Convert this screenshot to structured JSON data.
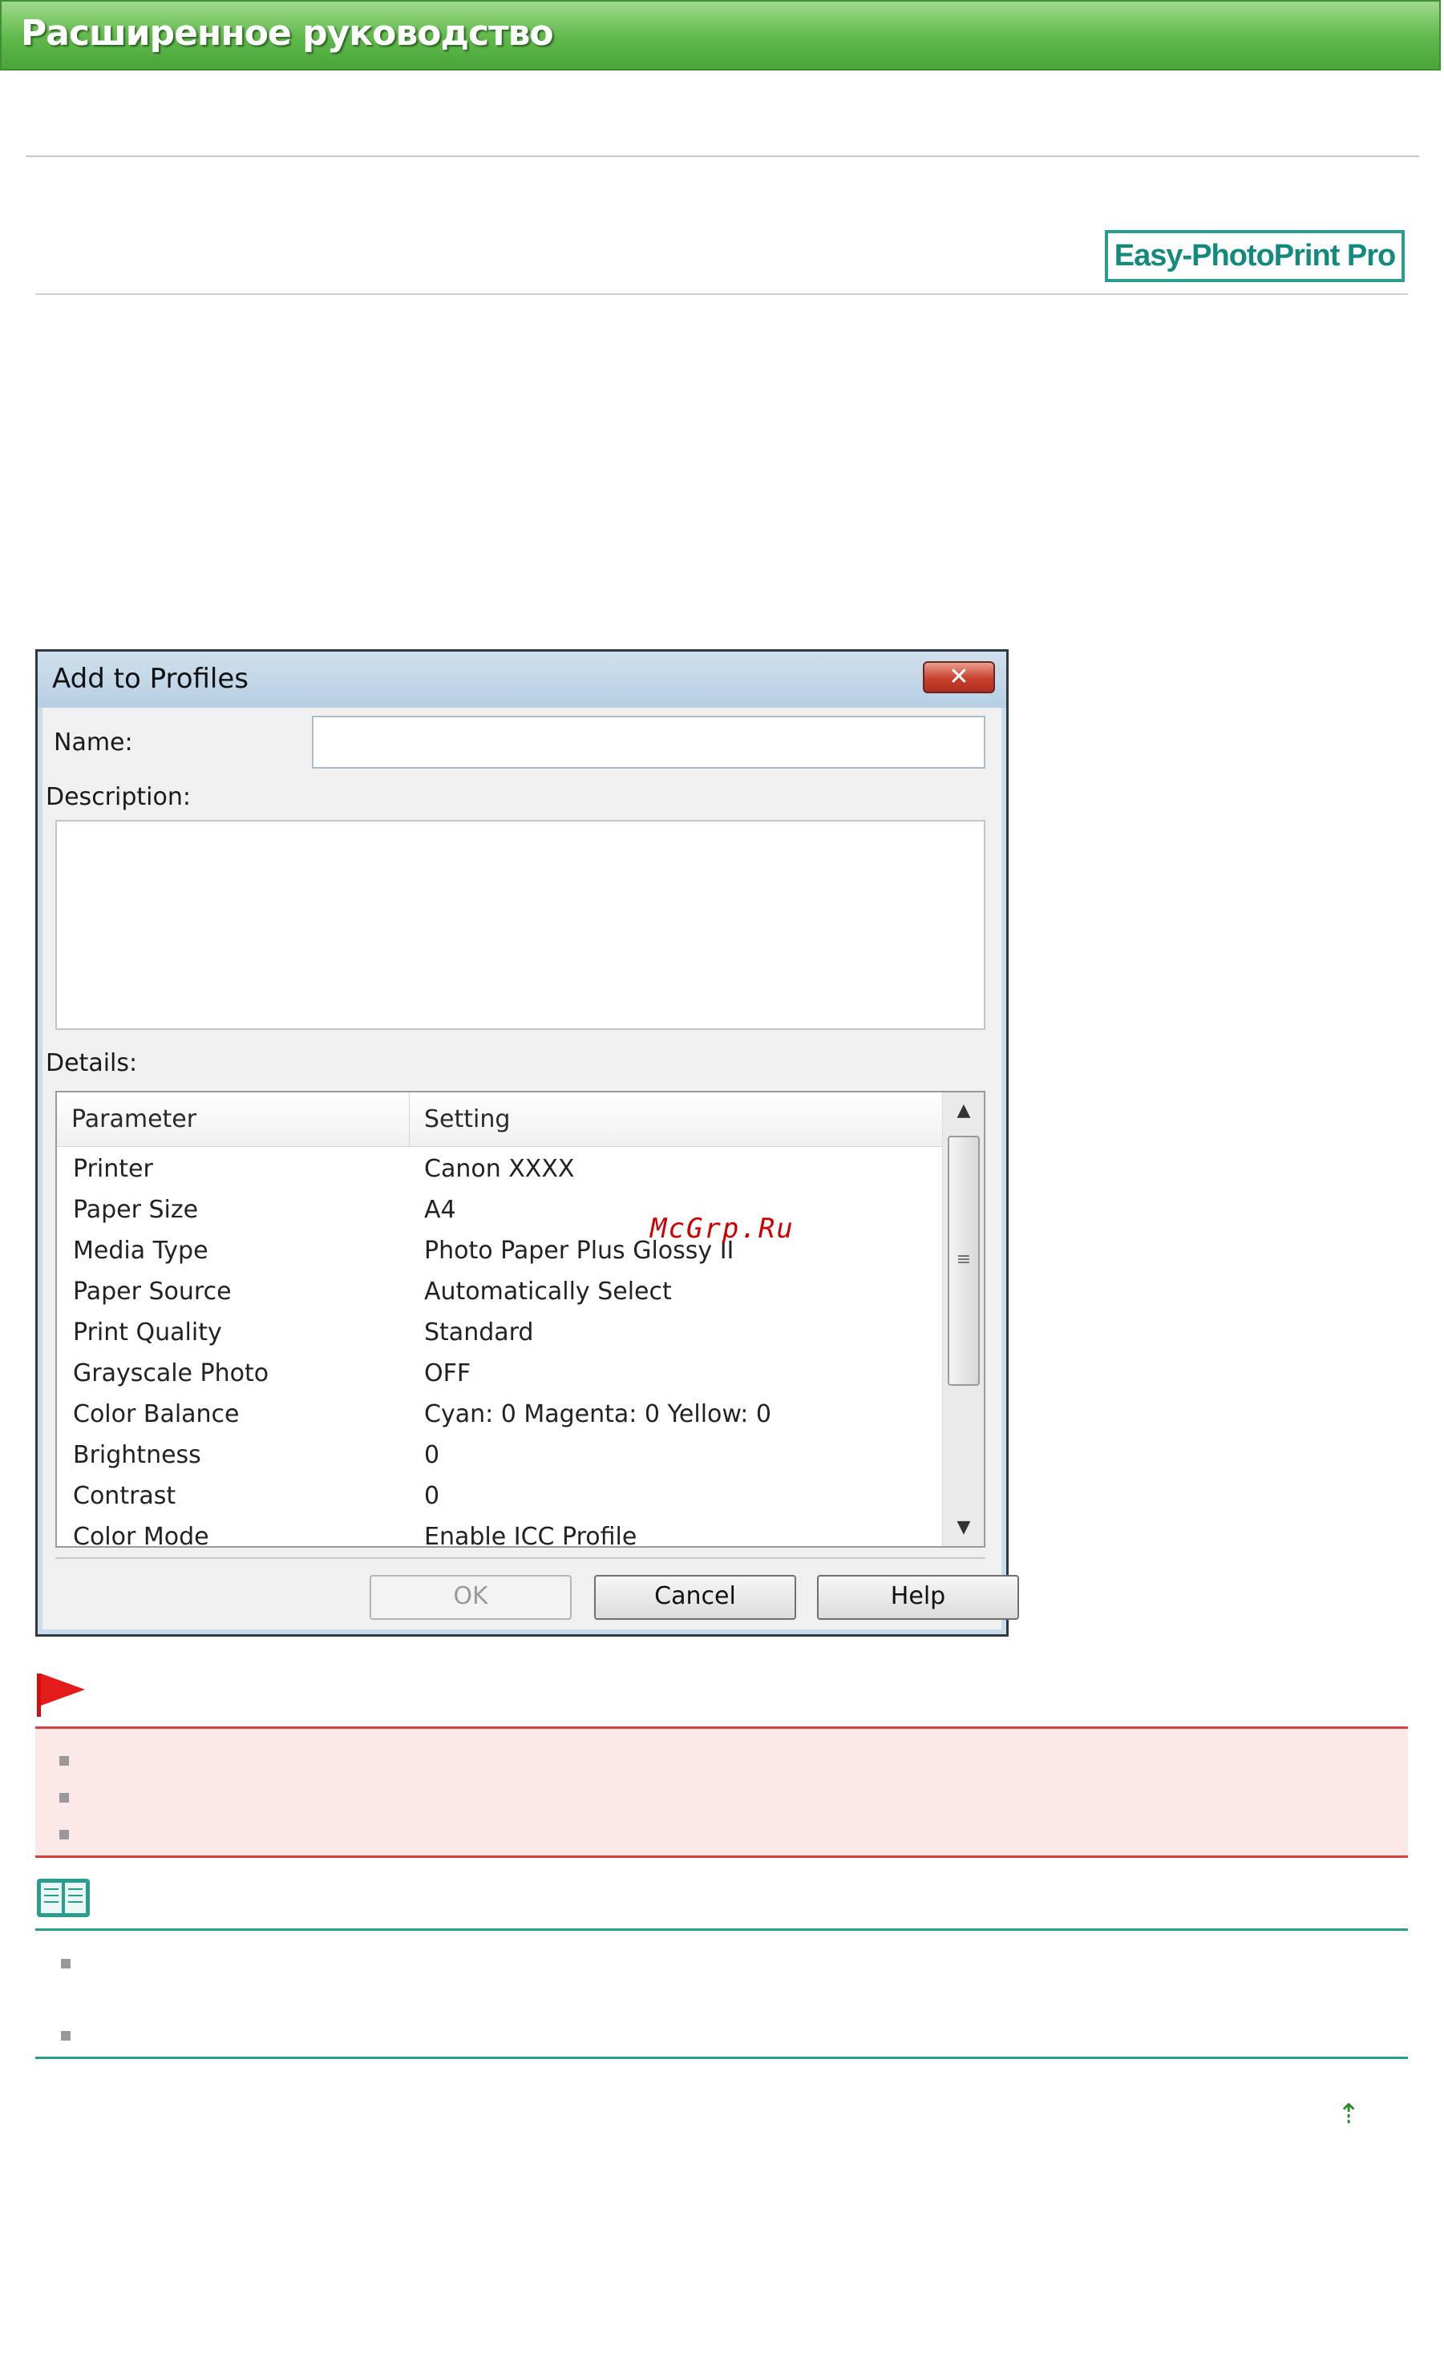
{
  "banner": {
    "title": "Расширенное руководство"
  },
  "product_badge": "Easy-PhotoPrint Pro",
  "dialog": {
    "title": "Add to Profiles",
    "close_symbol": "✕",
    "name_label": "Name:",
    "name_value": "",
    "description_label": "Description:",
    "description_value": "",
    "details_label": "Details:",
    "columns": {
      "parameter": "Parameter",
      "setting": "Setting"
    },
    "rows": [
      {
        "parameter": "Printer",
        "setting": "Canon XXXX"
      },
      {
        "parameter": "Paper Size",
        "setting": "A4"
      },
      {
        "parameter": "Media Type",
        "setting": "Photo Paper Plus Glossy II"
      },
      {
        "parameter": "Paper Source",
        "setting": "Automatically Select"
      },
      {
        "parameter": "Print Quality",
        "setting": "Standard"
      },
      {
        "parameter": "Grayscale Photo",
        "setting": "OFF"
      },
      {
        "parameter": "Color Balance",
        "setting": "Cyan: 0  Magenta: 0  Yellow: 0"
      },
      {
        "parameter": "Brightness",
        "setting": "0"
      },
      {
        "parameter": "Contrast",
        "setting": "0"
      },
      {
        "parameter": "Color Mode",
        "setting": "Enable ICC Profile"
      }
    ],
    "buttons": {
      "ok": "OK",
      "cancel": "Cancel",
      "help": "Help"
    },
    "ok_enabled": false
  },
  "watermark": "McGrp.Ru",
  "top_arrow": "⇡",
  "colors": {
    "banner_green": "#5fb84a",
    "badge_teal": "#2a9d8f",
    "important_red": "#d84040",
    "important_bg": "#fde8e8",
    "note_teal": "#2a9d8f"
  },
  "icons": [
    "flag-icon",
    "book-note-icon",
    "close-icon",
    "scroll-up-arrow",
    "scroll-down-arrow",
    "back-to-top-icon"
  ]
}
